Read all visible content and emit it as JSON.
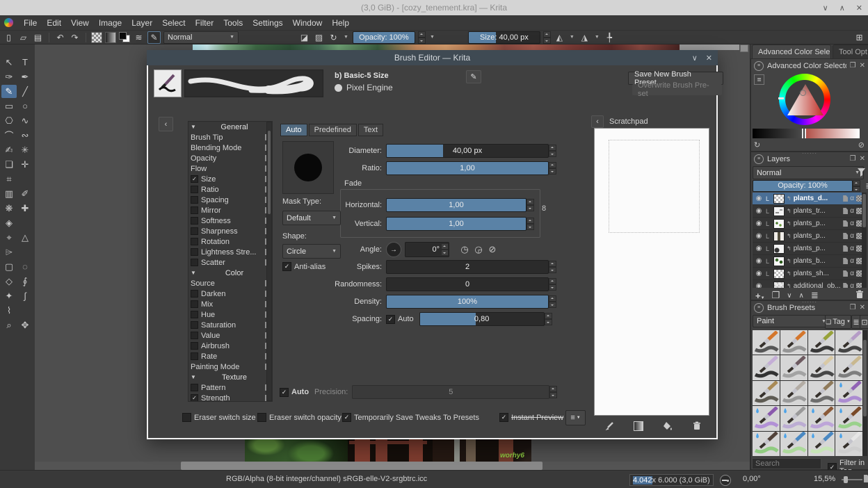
{
  "window": {
    "title": "(3,0 GiB) - [cozy_tenement.kra] — Krita",
    "controls": {
      "minimize": "∨",
      "maximize": "∧",
      "close": "✕"
    }
  },
  "menubar": {
    "items": [
      "File",
      "Edit",
      "View",
      "Image",
      "Layer",
      "Select",
      "Filter",
      "Tools",
      "Settings",
      "Window",
      "Help"
    ]
  },
  "toolbar": {
    "blend_mode": "Normal",
    "opacity_label": "Opacity: 100%",
    "opacity_fill": 100,
    "size_label": "Size: 40,00 px",
    "size_fill": 38
  },
  "toolbox": {
    "tools": [
      {
        "name": "select-shapes-tool",
        "glyph": "↖"
      },
      {
        "name": "text-tool",
        "glyph": "T"
      },
      {
        "name": "edit-shapes-tool",
        "glyph": "✑"
      },
      {
        "name": "calligraphy-tool",
        "glyph": "✒"
      },
      {
        "name": "freehand-brush-tool",
        "glyph": "✎",
        "selected": true
      },
      {
        "name": "line-tool",
        "glyph": "╱"
      },
      {
        "name": "rectangle-tool",
        "glyph": "▭"
      },
      {
        "name": "ellipse-tool",
        "glyph": "○"
      },
      {
        "name": "polygon-tool",
        "glyph": "⎔"
      },
      {
        "name": "polyline-tool",
        "glyph": "∿"
      },
      {
        "name": "bezier-curve-tool",
        "glyph": "⌒"
      },
      {
        "name": "freehand-path-tool",
        "glyph": "∾"
      },
      {
        "name": "dynamic-brush-tool",
        "glyph": "✍"
      },
      {
        "name": "multibrush-tool",
        "glyph": "✳"
      },
      {
        "name": "transform-tool",
        "glyph": "❏"
      },
      {
        "name": "move-tool",
        "glyph": "✛"
      },
      {
        "name": "crop-tool",
        "glyph": "⌗"
      },
      {
        "name": "",
        "glyph": ""
      },
      {
        "name": "gradient-tool",
        "glyph": "▥"
      },
      {
        "name": "color-sampler-tool",
        "glyph": "✐"
      },
      {
        "name": "pattern-tool",
        "glyph": "❋"
      },
      {
        "name": "smart-patch-tool",
        "glyph": "✚"
      },
      {
        "name": "fill-tool",
        "glyph": "◈"
      },
      {
        "name": "",
        "glyph": ""
      },
      {
        "name": "assistants-tool",
        "glyph": "⌖"
      },
      {
        "name": "measure-tool",
        "glyph": "△"
      },
      {
        "name": "reference-images-tool",
        "glyph": "⌲"
      },
      {
        "name": "",
        "glyph": ""
      },
      {
        "name": "rectangular-select-tool",
        "glyph": "▢"
      },
      {
        "name": "elliptical-select-tool",
        "glyph": "◌"
      },
      {
        "name": "polygonal-select-tool",
        "glyph": "◇"
      },
      {
        "name": "freehand-select-tool",
        "glyph": "∮"
      },
      {
        "name": "similar-color-select-tool",
        "glyph": "✦"
      },
      {
        "name": "bezier-select-tool",
        "glyph": "∫"
      },
      {
        "name": "magnetic-select-tool",
        "glyph": "⌇"
      },
      {
        "name": "",
        "glyph": ""
      },
      {
        "name": "zoom-tool",
        "glyph": "⌕"
      },
      {
        "name": "pan-tool",
        "glyph": "✥"
      }
    ]
  },
  "brush_editor": {
    "title": "Brush Editor — Krita",
    "controls": {
      "shade": "∨",
      "close": "✕"
    },
    "preset_name": "b) Basic-5 Size",
    "engine": "Pixel Engine",
    "save_new_label": "Save New Brush Preset...",
    "overwrite_label": "Overwrite Brush Pre­set",
    "scratchpad_title": "Scratchpad",
    "tabs": {
      "auto": "Auto",
      "predefined": "Predefined",
      "text": "Text"
    },
    "options": {
      "sections": [
        {
          "header": "General",
          "items": [
            {
              "label": "Brush Tip"
            },
            {
              "label": "Blending Mode"
            },
            {
              "label": "Opacity"
            },
            {
              "label": "Flow"
            },
            {
              "label": "Size",
              "check": true,
              "checked": true
            },
            {
              "label": "Ratio",
              "check": true
            },
            {
              "label": "Spacing",
              "check": true
            },
            {
              "label": "Mirror",
              "check": true
            },
            {
              "label": "Softness",
              "check": true
            },
            {
              "label": "Sharpness",
              "check": true
            },
            {
              "label": "Rotation",
              "check": true
            },
            {
              "label": "Lightness Stre...",
              "check": true
            },
            {
              "label": "Scatter",
              "check": true
            }
          ]
        },
        {
          "header": "Color",
          "items": [
            {
              "label": "Source"
            },
            {
              "label": "Darken",
              "check": true
            },
            {
              "label": "Mix",
              "check": true
            },
            {
              "label": "Hue",
              "check": true
            },
            {
              "label": "Saturation",
              "check": true
            },
            {
              "label": "Value",
              "check": true
            },
            {
              "label": "Airbrush",
              "check": true
            },
            {
              "label": "Rate",
              "check": true
            },
            {
              "label": "Painting Mode"
            }
          ]
        },
        {
          "header": "Texture",
          "items": [
            {
              "label": "Pattern",
              "check": true
            },
            {
              "label": "Strength",
              "check": true,
              "checked": true
            }
          ]
        }
      ]
    },
    "params": {
      "diameter": {
        "label": "Diameter:",
        "value": "40,00 px",
        "fill": 35
      },
      "ratio": {
        "label": "Ratio:",
        "value": "1,00",
        "fill": 100
      },
      "fade_label": "Fade",
      "horizontal": {
        "label": "Horizontal:",
        "value": "1,00",
        "fill": 100
      },
      "vertical": {
        "label": "Vertical:",
        "value": "1,00",
        "fill": 100
      },
      "mask_type_label": "Mask Type:",
      "mask_type": "Default",
      "shape_label": "Shape:",
      "shape": "Circle",
      "antialias_label": "Anti-alias",
      "angle": {
        "label": "Angle:",
        "value": "0°"
      },
      "spikes": {
        "label": "Spikes:",
        "value": "2",
        "fill": 0
      },
      "randomness": {
        "label": "Randomness:",
        "value": "0",
        "fill": 0
      },
      "density": {
        "label": "Density:",
        "value": "100%",
        "fill": 100
      },
      "spacing": {
        "label": "Spacing:",
        "auto_label": "Auto",
        "value": "0,80",
        "fill": 45
      },
      "precision": {
        "auto_label": "Auto",
        "label": "Precision:",
        "value": "5"
      }
    },
    "footer": {
      "eraser_size_label": "Eraser switch size",
      "eraser_opacity_label": "Eraser switch opacity",
      "tweaks_label": "Temporarily Save Tweaks To Presets",
      "instant_label": "Instant Preview"
    }
  },
  "dockers": {
    "tabs": [
      {
        "label": "Advanced Color Sele...",
        "active": true
      },
      {
        "label": "Tool Opt...",
        "active": false
      }
    ],
    "color_selector": {
      "title": "Advanced Color Selector"
    },
    "layers": {
      "title": "Layers",
      "blend_mode": "Normal",
      "opacity_label": "Opacity: 100%",
      "opacity_fill": 100,
      "rows": [
        {
          "name": "plants_d...",
          "selected": true,
          "badge": "L",
          "thumb": "checker"
        },
        {
          "name": "plants_tr...",
          "badge": "L",
          "thumb": "marks"
        },
        {
          "name": "plants_p...",
          "badge": "L",
          "thumb": "green"
        },
        {
          "name": "plants_p...",
          "badge": "L",
          "thumb": "strip"
        },
        {
          "name": "plants_p...",
          "badge": "L",
          "thumb": "blob"
        },
        {
          "name": "plants_b...",
          "badge": "L",
          "thumb": "plant"
        },
        {
          "name": "plants_sh...",
          "badge": "L",
          "thumb": "checker"
        },
        {
          "name": "additional_ob...",
          "badge": "",
          "thumb": "group"
        }
      ]
    },
    "presets": {
      "title": "Brush Presets",
      "tag_filter": "Paint",
      "tag_button": "Tag",
      "search_placeholder": "Search",
      "filter_label": "Filter in Tag",
      "cells": [
        {
          "handle": "#d4762c",
          "stroke": "#3f3f3f",
          "drop": false
        },
        {
          "handle": "#d4762c",
          "stroke": "#8a8a8a",
          "drop": false
        },
        {
          "handle": "#97a23a",
          "stroke": "#1d1d1d",
          "drop": false
        },
        {
          "handle": "#b59cc6",
          "stroke": "#2a2a2a",
          "drop": false
        },
        {
          "handle": "#c4aed6",
          "stroke": "#151515",
          "drop": false
        },
        {
          "handle": "#6d5a60",
          "stroke": "#9a9a9a",
          "drop": false
        },
        {
          "handle": "#d9c9a4",
          "stroke": "#2e2e2e",
          "drop": false
        },
        {
          "handle": "#c9b88f",
          "stroke": "#6f6f6f",
          "drop": false
        },
        {
          "handle": "#a98a55",
          "stroke": "#49453c",
          "drop": false
        },
        {
          "handle": "#b3aca4",
          "stroke": "#8f8f8f",
          "drop": false
        },
        {
          "handle": "#8f7a5a",
          "stroke": "#5a5a5a",
          "drop": false
        },
        {
          "handle": "#9163b5",
          "stroke": "#a57fd0",
          "drop": true
        },
        {
          "handle": "#8a59ad",
          "stroke": "#ab85d6",
          "drop": true
        },
        {
          "handle": "#9a9a9a",
          "stroke": "#b7a6d2",
          "drop": true
        },
        {
          "handle": "#8a5a38",
          "stroke": "#b99cd8",
          "drop": true
        },
        {
          "handle": "#7a4a28",
          "stroke": "#8fd07f",
          "drop": true
        },
        {
          "handle": "#52423a",
          "stroke": "#84ca72",
          "drop": true
        },
        {
          "handle": "#4a88c2",
          "stroke": "#a6da92",
          "drop": true
        },
        {
          "handle": "#4a88c2",
          "stroke": "#c4e8b2",
          "drop": true
        },
        {
          "handle": "#e6e6e6",
          "stroke": "#cccccc",
          "drop": true
        }
      ]
    }
  },
  "statusbar": {
    "color_profile": "RGB/Alpha (8-bit integer/channel)  sRGB-elle-V2-srgbtrc.icc",
    "dim_selected": "4.042",
    "dim_rest": " x 6.000 (3,0 GiB)",
    "rotation": "0,00°",
    "zoom": "15,5%"
  },
  "painting": {
    "signature": "worhy6"
  },
  "colors": {
    "accent_blue": "#5a82a6",
    "selection_blue": "#4a6f96",
    "dialog_titlebar": "#3f4a53"
  }
}
